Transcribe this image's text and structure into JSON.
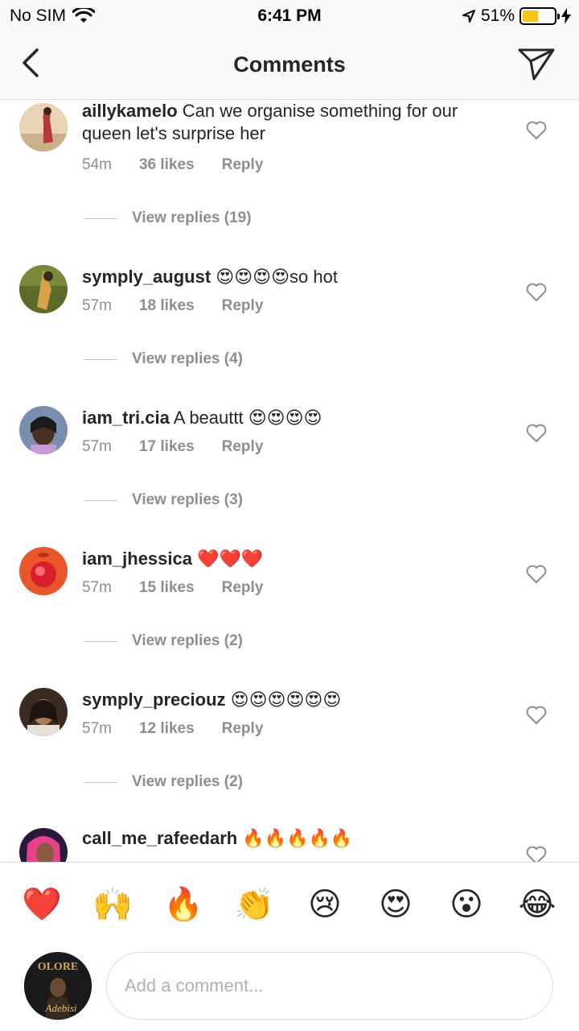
{
  "status": {
    "carrier": "No SIM",
    "time": "6:41 PM",
    "battery_percent": "51%",
    "battery_level": 0.51,
    "battery_color": "#f5c518"
  },
  "nav": {
    "title": "Comments",
    "back_icon": "chevron-left-icon",
    "send_icon": "paper-plane-icon"
  },
  "comments": [
    {
      "username": "aillykamelo",
      "text": "Can we organise something for our queen  let's surprise her",
      "time": "54m",
      "likes": "36 likes",
      "reply": "Reply",
      "view_replies": "View replies (19)"
    },
    {
      "username": "symply_august",
      "text": "😍😍😍😍so hot",
      "time": "57m",
      "likes": "18 likes",
      "reply": "Reply",
      "view_replies": "View replies (4)"
    },
    {
      "username": "iam_tri.cia",
      "text": "A beauttt 😍😍😍😍",
      "time": "57m",
      "likes": "17 likes",
      "reply": "Reply",
      "view_replies": "View replies (3)"
    },
    {
      "username": "iam_jhessica",
      "text": "❤️❤️❤️",
      "time": "57m",
      "likes": "15 likes",
      "reply": "Reply",
      "view_replies": "View replies (2)"
    },
    {
      "username": "symply_preciouz",
      "text": "😍😍😍😍😍😍",
      "time": "57m",
      "likes": "12 likes",
      "reply": "Reply",
      "view_replies": "View replies (2)"
    },
    {
      "username": "call_me_rafeedarh",
      "text": "🔥🔥🔥🔥🔥"
    }
  ],
  "emoji_bar": [
    "❤️",
    "🙌",
    "🔥",
    "👏",
    "😢",
    "😍",
    "😮",
    "😂"
  ],
  "composer": {
    "placeholder": "Add a comment...",
    "avatar_text": "OLORE",
    "avatar_signature": "Adebisi"
  }
}
